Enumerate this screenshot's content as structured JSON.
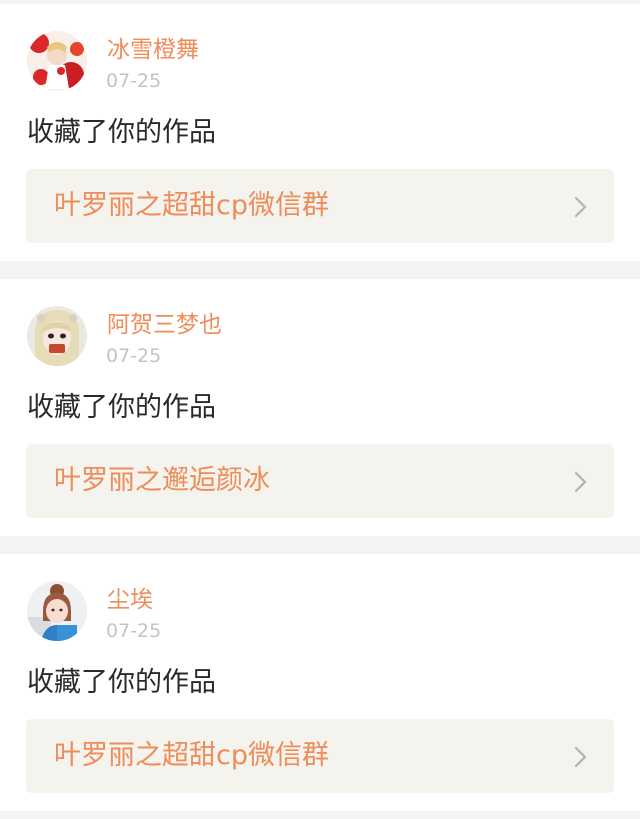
{
  "notifications": [
    {
      "username": "冰雪橙舞",
      "date": "07-25",
      "action": "收藏了你的作品",
      "work_title": "叶罗丽之超甜cp微信群",
      "avatar_icon": "avatar-red-flowers"
    },
    {
      "username": "阿贺三梦也",
      "date": "07-25",
      "action": "收藏了你的作品",
      "work_title": "叶罗丽之邂逅颜冰",
      "avatar_icon": "avatar-doll-face"
    },
    {
      "username": "尘埃",
      "date": "07-25",
      "action": "收藏了你的作品",
      "work_title": "叶罗丽之超甜cp微信群",
      "avatar_icon": "avatar-girl-blue"
    }
  ],
  "colors": {
    "accent": "#ee8c5a",
    "timestamp": "#c4c4c4",
    "body_text": "#2a2a2a",
    "card_bg": "#ffffff",
    "link_bg": "#f4f3ee",
    "page_bg": "#f4f3f1"
  },
  "icons": {
    "chevron": "chevron-right-icon"
  }
}
